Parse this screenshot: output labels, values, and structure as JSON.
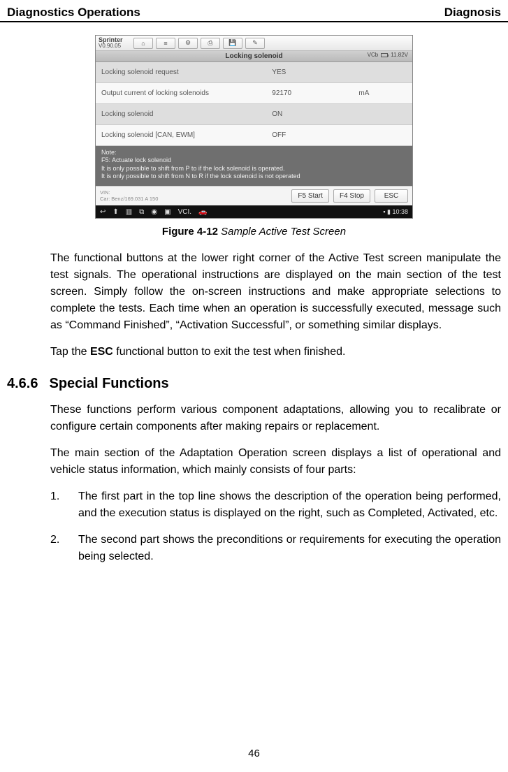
{
  "header": {
    "left": "Diagnostics Operations",
    "right": "Diagnosis"
  },
  "figure": {
    "brand_name": "Sprinter",
    "brand_ver": "V0.90.05",
    "toolbar_icons": [
      "home-icon",
      "separator-icon",
      "settings-icon",
      "print-icon",
      "save-icon",
      "pencil-icon"
    ],
    "title": "Locking solenoid",
    "vci_label": "VCb",
    "voltage": "11.82V",
    "rows": [
      {
        "label": "Locking solenoid request",
        "value": "YES",
        "unit": ""
      },
      {
        "label": "Output current of locking solenoids",
        "value": "92170",
        "unit": "mA"
      },
      {
        "label": "Locking solenoid",
        "value": "ON",
        "unit": ""
      },
      {
        "label": "Locking solenoid [CAN, EWM]",
        "value": "OFF",
        "unit": ""
      }
    ],
    "note_heading": "Note:",
    "note_lines": [
      "F5: Actuate lock solenoid",
      "It is only possible to shift from P to if the lock solenoid is operated.",
      "It is only possible to shift from N to R if the lock solenoid is not operated"
    ],
    "vin_label": "VIN:",
    "car_label": "Car: Benz/169.031 A 150",
    "buttons": [
      "F5 Start",
      "F4 Stop",
      "ESC"
    ],
    "sys_icons": [
      "back-icon",
      "up-icon",
      "apps-icon",
      "screenshot-icon",
      "camera-icon",
      "record-icon",
      "vci-icon",
      "car-icon"
    ],
    "sys_time": "10:38"
  },
  "caption": {
    "label": "Figure 4-12",
    "title": "Sample Active Test Screen"
  },
  "para1": "The functional buttons at the lower right corner of the Active Test screen manipulate the test signals. The operational instructions are displayed on the main section of the test screen. Simply follow the on-screen instructions and make appropriate selections to complete the tests. Each time when an operation is successfully executed, message such as “Command Finished”, “Activation Successful”, or something similar displays.",
  "para2_pre": "Tap the ",
  "para2_bold": "ESC",
  "para2_post": " functional button to exit the test when finished.",
  "section": {
    "number": "4.6.6",
    "title": "Special Functions"
  },
  "para3": "These functions perform various component adaptations, allowing you to recalibrate or configure certain components after making repairs or replacement.",
  "para4": "The main section of the Adaptation Operation screen displays a list of operational and vehicle status information, which mainly consists of four parts:",
  "list": [
    {
      "num": "1.",
      "text": "The first part in the top line shows the description of the operation being performed, and the execution status is displayed on the right, such as Completed, Activated, etc."
    },
    {
      "num": "2.",
      "text": "The second part shows the preconditions or requirements for executing the operation being selected."
    }
  ],
  "page_number": "46"
}
